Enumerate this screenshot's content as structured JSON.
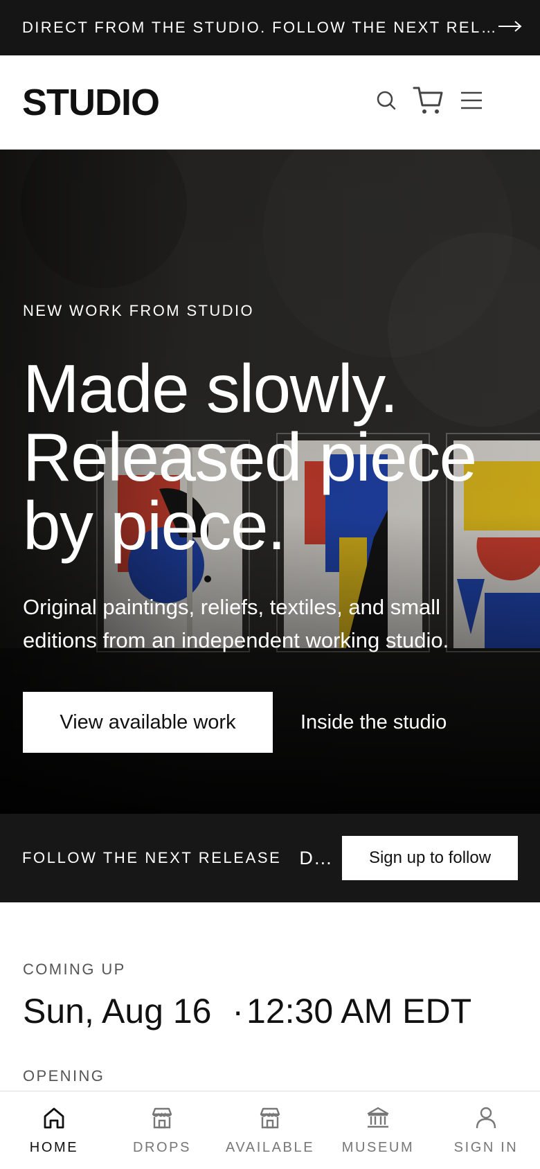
{
  "announcement": {
    "text": "DIRECT FROM THE STUDIO. FOLLOW THE NEXT REL…",
    "arrow_icon": "arrow-right-icon"
  },
  "header": {
    "logo": "STUDIO",
    "icons": [
      "search-icon",
      "cart-icon",
      "menu-icon"
    ]
  },
  "hero": {
    "eyebrow": "NEW WORK FROM STUDIO",
    "headline_line1": "Made slowly.",
    "headline_line2": "Released piece",
    "headline_line3": "by piece.",
    "lede": "Original paintings, reliefs, textiles, and small editions from an independent working studio.",
    "primary_cta": "View available work",
    "secondary_cta": "Inside the studio"
  },
  "follow_bar": {
    "label": "FOLLOW THE NEXT RELEASE",
    "truncated": "D…",
    "button": "Sign up to follow"
  },
  "coming_up": {
    "label": "COMING UP",
    "date": "Sun, Aug 16",
    "separator": "·",
    "time": "12:30 AM EDT",
    "opening_label": "OPENING"
  },
  "bottom_nav": {
    "items": [
      {
        "label": "HOME",
        "icon": "home-icon",
        "active": true
      },
      {
        "label": "DROPS",
        "icon": "store-icon",
        "active": false
      },
      {
        "label": "AVAILABLE",
        "icon": "store-icon",
        "active": false
      },
      {
        "label": "MUSEUM",
        "icon": "museum-icon",
        "active": false
      },
      {
        "label": "SIGN IN",
        "icon": "user-icon",
        "active": false
      }
    ]
  },
  "colors": {
    "dark_bar": "#151515",
    "accent_red": "#d8402f",
    "accent_blue": "#1f47b8",
    "accent_yellow": "#e9c21a"
  }
}
